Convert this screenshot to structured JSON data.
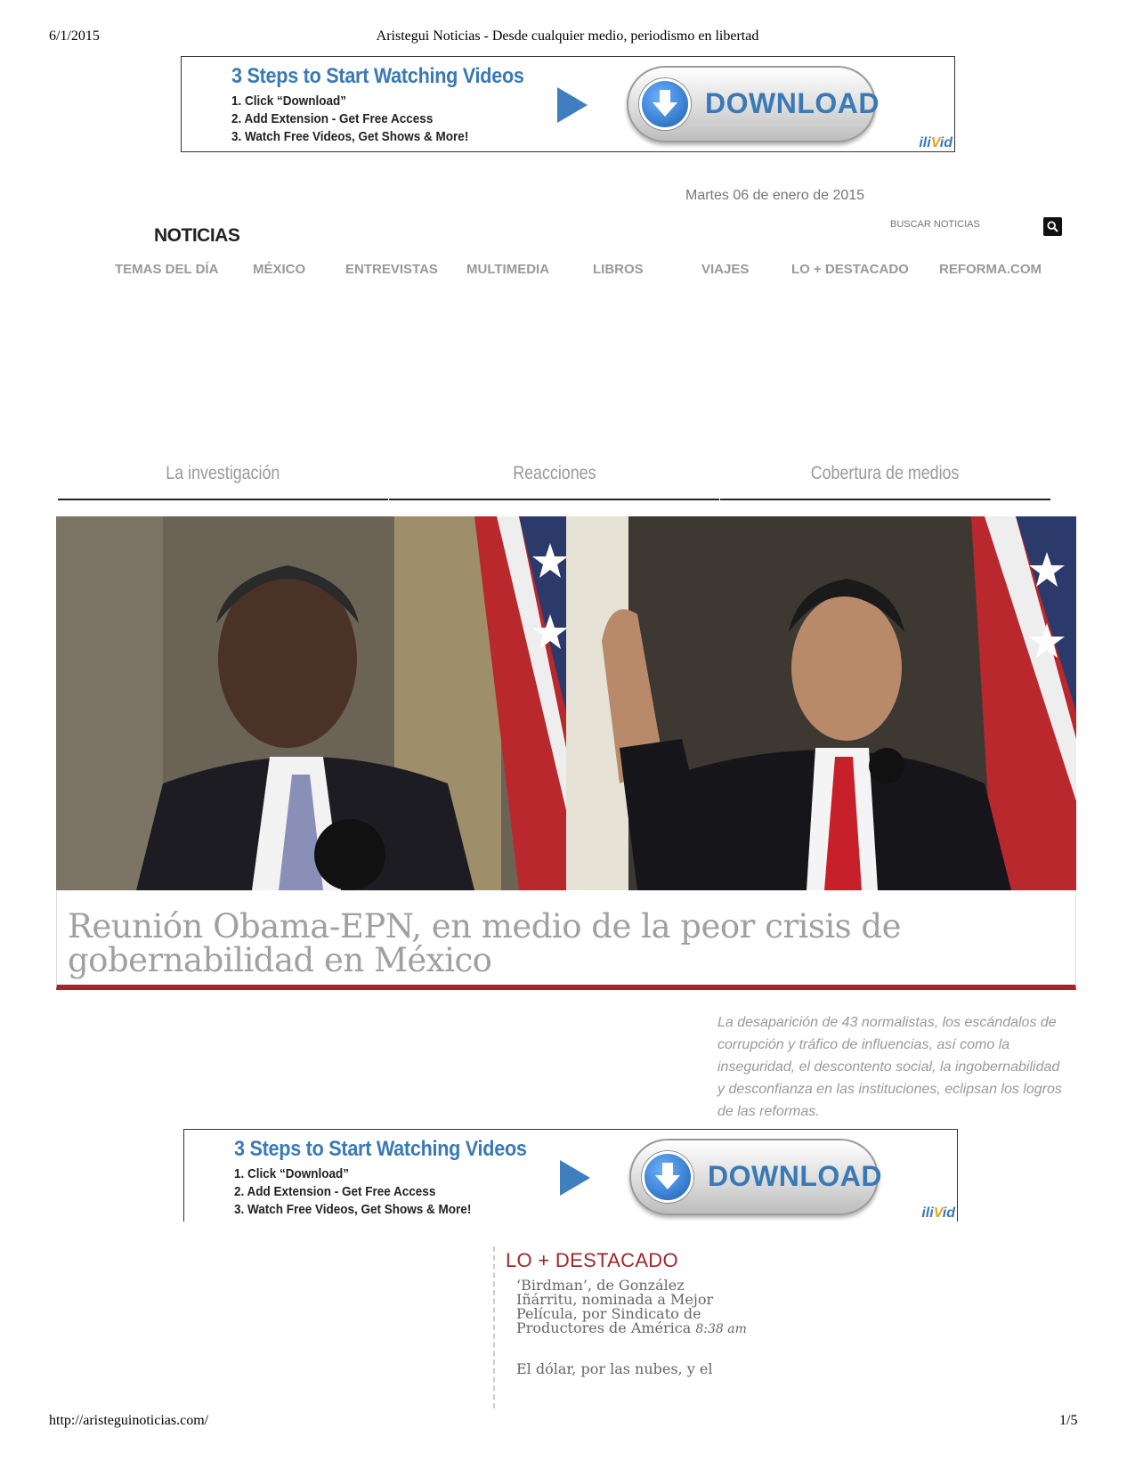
{
  "print_header": {
    "date": "6/1/2015",
    "title": "Aristegui Noticias - Desde cualquier medio, periodismo en libertad"
  },
  "ads": [
    {
      "title": "3 Steps to Start Watching Videos",
      "steps": [
        "1. Click “Download”",
        "2. Add Extension - Get Free Access",
        "3. Watch Free Videos, Get Shows & More!"
      ],
      "button_label": "DOWNLOAD",
      "brand_a": "ili",
      "brand_v": "V",
      "brand_b": "id"
    },
    {
      "title": "3 Steps to Start Watching Videos",
      "steps": [
        "1. Click “Download”",
        "2. Add Extension - Get Free Access",
        "3. Watch Free Videos, Get Shows & More!"
      ],
      "button_label": "DOWNLOAD",
      "brand_a": "ili",
      "brand_v": "V",
      "brand_b": "id"
    }
  ],
  "header": {
    "date": "Martes 06 de enero de 2015",
    "logo": "NOTICIAS",
    "search_placeholder": "BUSCAR NOTICIAS"
  },
  "nav": [
    "TEMAS DEL DÍA",
    "MÉXICO",
    "ENTREVISTAS",
    "MULTIMEDIA",
    "LIBROS",
    "VIAJES",
    "LO + DESTACADO",
    "REFORMA.COM"
  ],
  "subnav": [
    "La investigación",
    "Reacciones",
    "Cobertura de medios"
  ],
  "hero": {
    "headline": "Reunión Obama-EPN, en medio de la peor crisis de gobernabilidad en México",
    "summary": "La desaparición de 43 normalistas, los escándalos de corrupción y tráfico de influencias, así como la inseguridad, el descontento social, la ingobernabilidad y desconfianza en las instituciones, eclipsan los logros de las reformas."
  },
  "sidebar": {
    "title": "LO + DESTACADO",
    "items": [
      {
        "text": "‘Birdman’, de González Iñárritu, nominada a Mejor Película, por Sindicato de Productores de América",
        "time": "8:38 am"
      },
      {
        "text": "El dólar, por las nubes, y el",
        "time": ""
      }
    ]
  },
  "print_footer": {
    "url": "http://aristeguinoticias.com/",
    "page": "1/5"
  },
  "colors": {
    "accent_red": "#a3262a",
    "ad_blue": "#3a79b5",
    "nav_gray": "#999999"
  }
}
